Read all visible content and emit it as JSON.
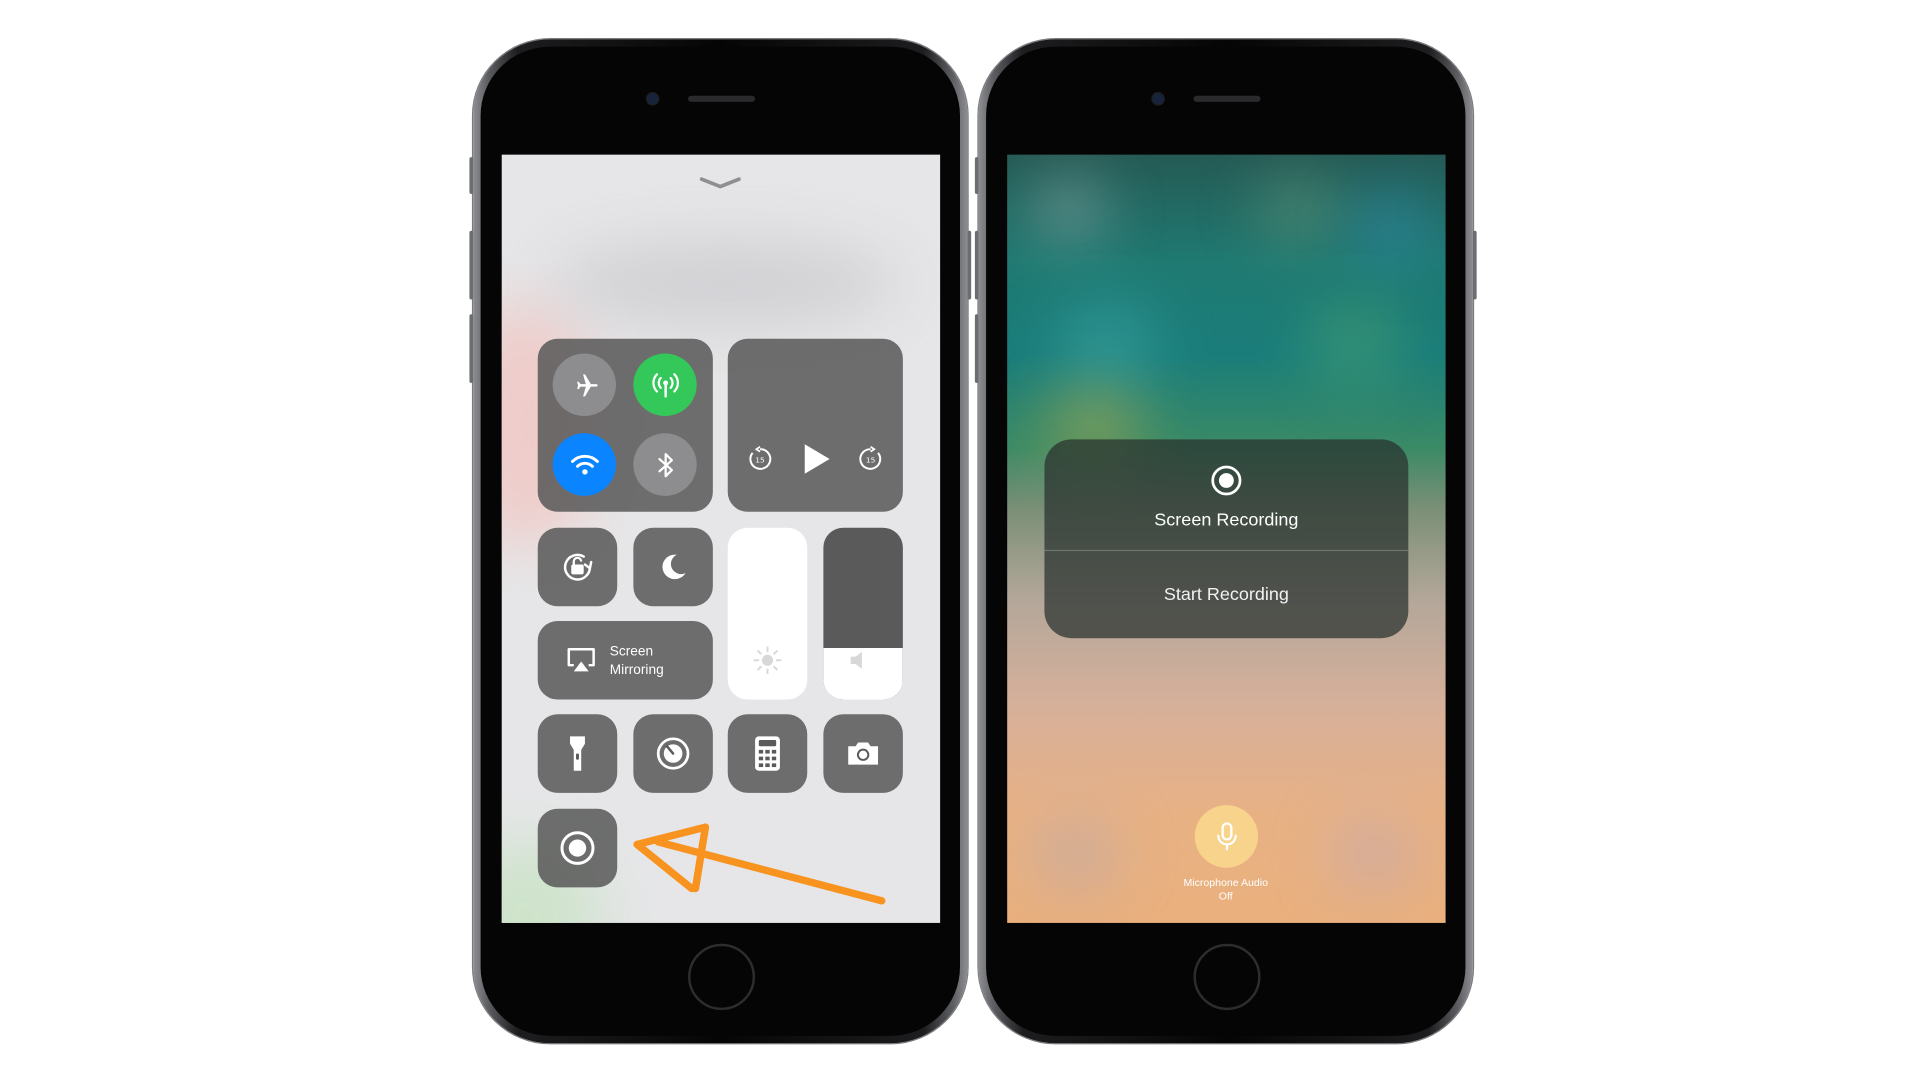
{
  "left_phone": {
    "control_center": {
      "connectivity": {
        "airplane": {
          "icon": "airplane-icon",
          "state": "off"
        },
        "cellular": {
          "icon": "antenna-icon",
          "state": "on",
          "color": "#34c759"
        },
        "wifi": {
          "icon": "wifi-icon",
          "state": "on",
          "color": "#0a84ff"
        },
        "bluetooth": {
          "icon": "bluetooth-icon",
          "state": "off"
        }
      },
      "media": {
        "icons": [
          "skip-back-15-icon",
          "play-icon",
          "skip-forward-15-icon"
        ]
      },
      "toggles": [
        {
          "icon": "rotation-lock-icon"
        },
        {
          "icon": "moon-icon"
        }
      ],
      "screen_mirroring": {
        "line1": "Screen",
        "line2": "Mirroring",
        "icon": "airplay-icon"
      },
      "brightness": {
        "icon": "sun-icon",
        "level": 1.0
      },
      "volume": {
        "icon": "speaker-icon",
        "level": 0.3
      },
      "shortcuts": [
        {
          "icon": "flashlight-icon"
        },
        {
          "icon": "timer-icon"
        },
        {
          "icon": "calculator-icon"
        },
        {
          "icon": "camera-icon"
        }
      ],
      "screen_record": {
        "icon": "record-icon"
      }
    },
    "annotation": {
      "type": "arrow",
      "color": "#f7931e"
    }
  },
  "right_phone": {
    "panel": {
      "icon": "record-icon",
      "title": "Screen Recording",
      "action": "Start Recording"
    },
    "microphone": {
      "icon": "microphone-icon",
      "label_line1": "Microphone Audio",
      "label_line2": "Off",
      "color": "#f8d68c"
    }
  }
}
